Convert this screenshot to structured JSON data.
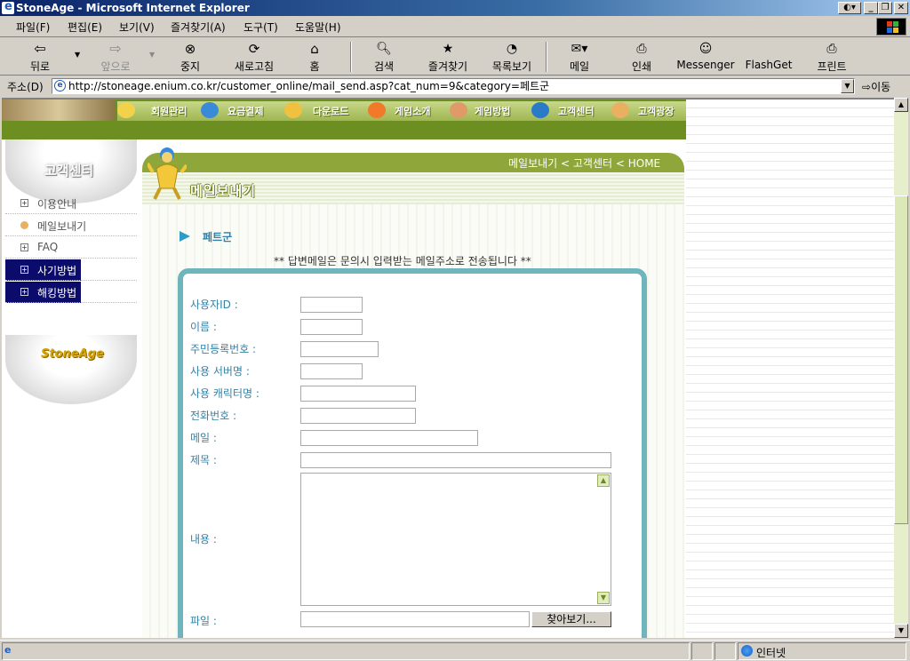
{
  "window": {
    "title": "StoneAge - Microsoft Internet Explorer"
  },
  "menu": [
    "파일(F)",
    "편집(E)",
    "보기(V)",
    "즐겨찾기(A)",
    "도구(T)",
    "도움말(H)"
  ],
  "toolbar": {
    "back": "뒤로",
    "forward": "앞으로",
    "stop": "중지",
    "refresh": "새로고침",
    "home": "홈",
    "search": "검색",
    "favorites": "즐겨찾기",
    "history": "목록보기",
    "mail": "메일",
    "print": "인쇄",
    "messenger": "Messenger",
    "flashget": "FlashGet",
    "printer": "프린트"
  },
  "address": {
    "label": "주소(D)",
    "url": "http://stoneage.enium.co.kr/customer_online/mail_send.asp?cat_num=9&category=페트군",
    "go": "이동"
  },
  "site_nav": [
    "회원관리",
    "요금결제",
    "다운로드",
    "게임소개",
    "게임방법",
    "고객센터",
    "고객광장"
  ],
  "sidebar": {
    "title": "고객센터",
    "items": [
      {
        "label": "이용안내"
      },
      {
        "label": "메일보내기"
      },
      {
        "label": "FAQ"
      },
      {
        "label": "사기방법"
      },
      {
        "label": "해킹방법"
      }
    ],
    "logo": "StoneAge"
  },
  "content": {
    "breadcrumb": "메일보내기 < 고객센터 < HOME",
    "page_title": "메일보내기",
    "category": "페트군",
    "notice": "** 답변메일은 문의시 입력받는 메일주소로 전송됩니다 **"
  },
  "form": {
    "userid": "사용자ID :",
    "name": "이름 :",
    "ssn": "주민등록번호 :",
    "server": "사용 서버명 :",
    "character": "사용 캐릭터명 :",
    "phone": "전화번호 :",
    "email": "메일 :",
    "subject": "제목 :",
    "body": "내용 :",
    "file": "파일 :",
    "browse": "찾아보기..."
  },
  "status": {
    "zone": "인터넷"
  }
}
